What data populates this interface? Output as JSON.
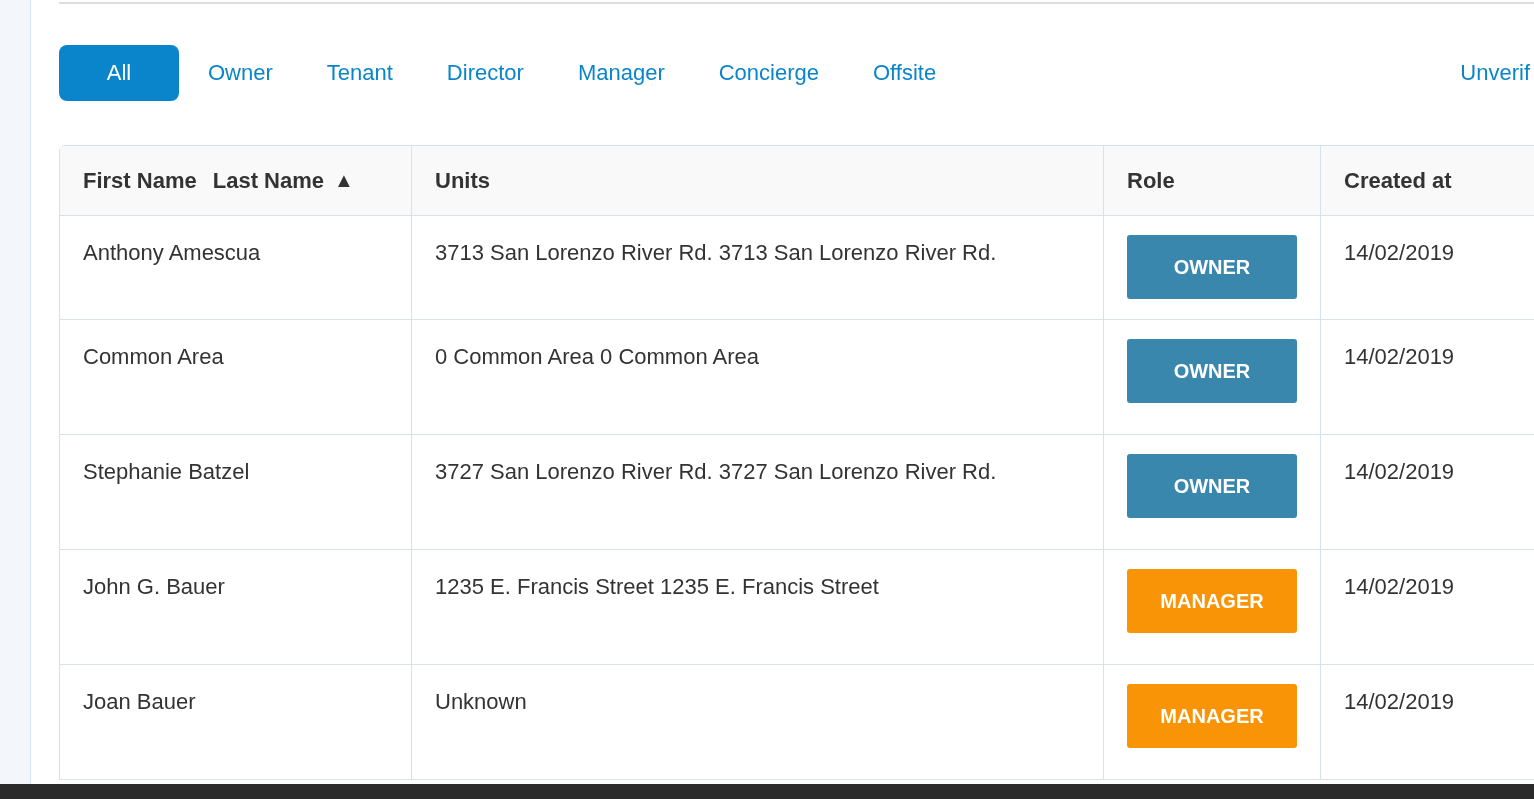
{
  "tabs": [
    {
      "label": "All",
      "selected": true
    },
    {
      "label": "Owner",
      "selected": false
    },
    {
      "label": "Tenant",
      "selected": false
    },
    {
      "label": "Director",
      "selected": false
    },
    {
      "label": "Manager",
      "selected": false
    },
    {
      "label": "Concierge",
      "selected": false
    },
    {
      "label": "Offsite",
      "selected": false
    },
    {
      "label": "Unverif",
      "selected": false
    }
  ],
  "table": {
    "columns": [
      {
        "labels": [
          "First Name",
          "Last Name"
        ],
        "sort": "▲"
      },
      {
        "labels": [
          "Units"
        ]
      },
      {
        "labels": [
          "Role"
        ]
      },
      {
        "labels": [
          "Created at"
        ]
      }
    ],
    "rows": [
      {
        "name": "Anthony Amescua",
        "units": "3713 San Lorenzo River Rd. 3713 San Lorenzo River Rd.",
        "role": {
          "label": "OWNER",
          "kind": "owner"
        },
        "created_at": "14/02/2019"
      },
      {
        "name": "Common Area",
        "units": "0 Common Area 0 Common Area",
        "role": {
          "label": "OWNER",
          "kind": "owner"
        },
        "created_at": "14/02/2019"
      },
      {
        "name": "Stephanie Batzel",
        "units": "3727 San Lorenzo River Rd. 3727 San Lorenzo River Rd.",
        "role": {
          "label": "OWNER",
          "kind": "owner"
        },
        "created_at": "14/02/2019"
      },
      {
        "name": "John G. Bauer",
        "units": "1235 E. Francis Street 1235 E. Francis Street",
        "role": {
          "label": "MANAGER",
          "kind": "manager"
        },
        "created_at": "14/02/2019"
      },
      {
        "name": "Joan Bauer",
        "units": "Unknown",
        "role": {
          "label": "MANAGER",
          "kind": "manager"
        },
        "created_at": "14/02/2019"
      }
    ]
  }
}
